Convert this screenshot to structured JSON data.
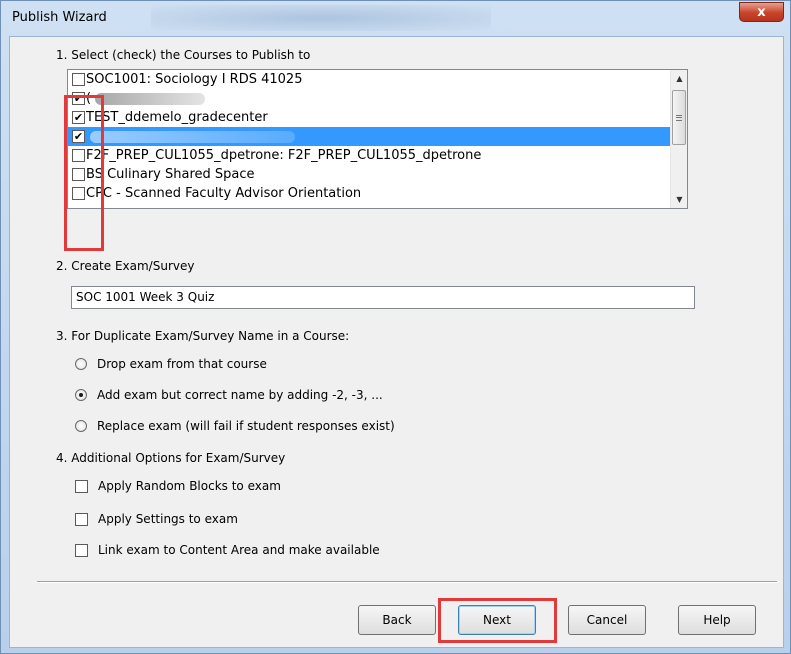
{
  "window": {
    "title": "Publish Wizard",
    "close_glyph": "x"
  },
  "section1": {
    "label": "1. Select (check) the Courses to Publish to",
    "courses": [
      {
        "label": "SOC1001: Sociology I RDS 41025",
        "checked": false,
        "selected": false
      },
      {
        "label": "(",
        "checked": true,
        "selected": false,
        "redacted": true
      },
      {
        "label": "TEST_ddemelo_gradecenter",
        "checked": true,
        "selected": false
      },
      {
        "label": "",
        "checked": true,
        "selected": true,
        "redacted": true
      },
      {
        "label": "F2F_PREP_CUL1055_dpetrone: F2F_PREP_CUL1055_dpetrone",
        "checked": false,
        "selected": false
      },
      {
        "label": "BS Culinary Shared Space",
        "checked": false,
        "selected": false
      },
      {
        "label": "CPC - Scanned Faculty Advisor Orientation",
        "checked": false,
        "selected": false
      }
    ]
  },
  "section2": {
    "label": "2. Create Exam/Survey",
    "exam_name": "SOC 1001 Week 3 Quiz"
  },
  "section3": {
    "label": "3. For Duplicate Exam/Survey Name in a Course:",
    "options": [
      {
        "label": "Drop exam from that course",
        "selected": false
      },
      {
        "label": "Add exam but correct name by adding -2, -3, ...",
        "selected": true
      },
      {
        "label": "Replace exam (will fail if student responses exist)",
        "selected": false
      }
    ]
  },
  "section4": {
    "label": "4. Additional Options for Exam/Survey",
    "options": [
      {
        "label": "Apply Random Blocks to exam",
        "checked": false
      },
      {
        "label": "Apply Settings to exam",
        "checked": false
      },
      {
        "label": "Link exam to Content Area and make available",
        "checked": false
      }
    ]
  },
  "buttons": {
    "back": "Back",
    "next": "Next",
    "cancel": "Cancel",
    "help": "Help"
  },
  "colors": {
    "selection": "#3399ff",
    "annotation_red": "#e23a3a"
  }
}
